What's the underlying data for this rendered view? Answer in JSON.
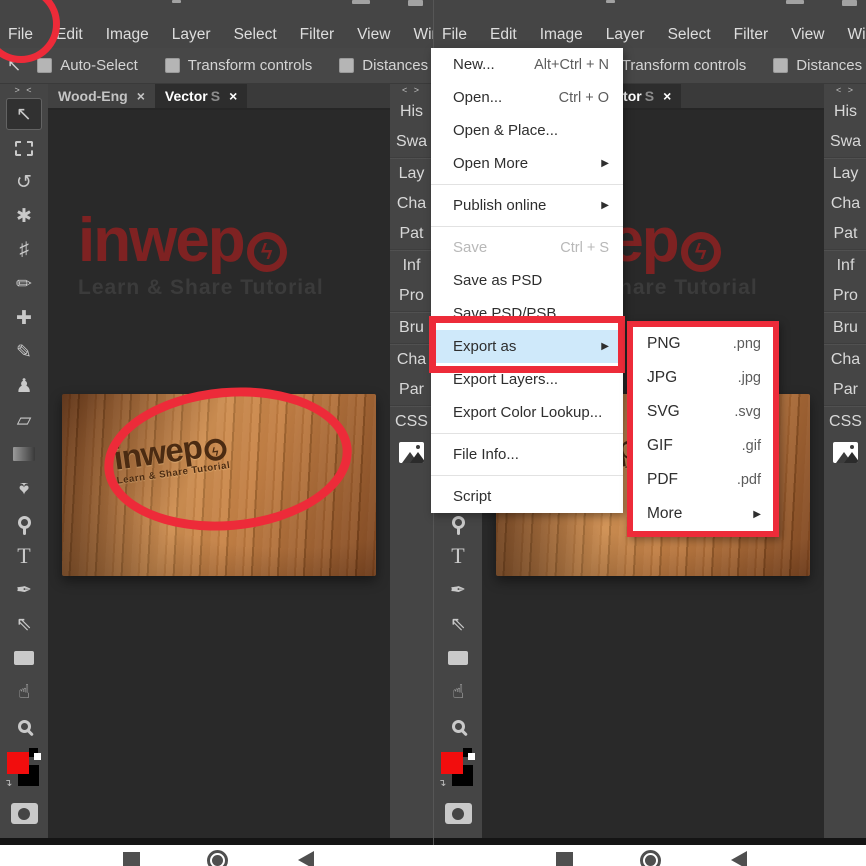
{
  "menubar": {
    "items": [
      "File",
      "Edit",
      "Image",
      "Layer",
      "Select",
      "Filter",
      "View",
      "Windo"
    ]
  },
  "optionsbar": {
    "move_tool_glyph": "↖",
    "auto_select": "Auto-Select",
    "transform_controls": "Transform controls",
    "distances": "Distances"
  },
  "tabs": {
    "tab1_label": "Wood-Eng",
    "tab2_label": "Vector",
    "tab2_tail": "S",
    "close": "×"
  },
  "tool_column": {
    "header": "> <",
    "tools": [
      {
        "name": "move-tool",
        "glyph": "↖"
      },
      {
        "name": "marquee-tool",
        "glyph": ""
      },
      {
        "name": "lasso-tool",
        "glyph": "↺"
      },
      {
        "name": "quick-select-tool",
        "glyph": "✱"
      },
      {
        "name": "crop-tool",
        "glyph": "♯"
      },
      {
        "name": "eyedropper-tool",
        "glyph": "✏"
      },
      {
        "name": "healing-tool",
        "glyph": "✚"
      },
      {
        "name": "brush-tool",
        "glyph": "✎"
      },
      {
        "name": "clone-stamp-tool",
        "glyph": "♟"
      },
      {
        "name": "eraser-tool",
        "glyph": "▱"
      },
      {
        "name": "gradient-tool",
        "glyph": ""
      },
      {
        "name": "blur-tool",
        "glyph": "♠"
      },
      {
        "name": "dodge-tool",
        "glyph": ""
      },
      {
        "name": "type-tool",
        "glyph": "T"
      },
      {
        "name": "pen-tool",
        "glyph": "✒"
      },
      {
        "name": "path-select-tool",
        "glyph": "⇖"
      },
      {
        "name": "shape-tool",
        "glyph": ""
      },
      {
        "name": "hand-tool",
        "glyph": "☝"
      },
      {
        "name": "zoom-tool",
        "glyph": ""
      }
    ],
    "swap_arrow": "↴"
  },
  "panel_strip": {
    "header": "< >",
    "groups": [
      [
        "His",
        "Swa"
      ],
      [
        "Lay",
        "Cha",
        "Pat"
      ],
      [
        "Inf",
        "Pro"
      ],
      [
        "Bru"
      ],
      [
        "Cha",
        "Par"
      ],
      [
        "CSS"
      ]
    ],
    "flat": {
      "0": "His",
      "1": "Swa",
      "2": "Lay",
      "3": "Cha",
      "4": "Pat",
      "5": "Inf",
      "6": "Pro",
      "7": "Bru",
      "8": "Cha",
      "9": "Par",
      "10": "CSS"
    }
  },
  "canvas": {
    "logo_word": "inwep",
    "logo_bolt": "ϟ",
    "logo_tagline": "Learn & Share Tutorial",
    "wood_logo_word": "inwep",
    "wood_tagline": "Learn & Share Tutorial"
  },
  "file_menu": {
    "items": [
      {
        "label": "New...",
        "shortcut": "Alt+Ctrl + N"
      },
      {
        "label": "Open...",
        "shortcut": "Ctrl + O"
      },
      {
        "label": "Open & Place..."
      },
      {
        "label": "Open More",
        "arrow": "▶"
      },
      {
        "label": "Publish online",
        "arrow": "▶"
      },
      {
        "label": "Save",
        "shortcut": "Ctrl + S",
        "disabled": true
      },
      {
        "label": "Save as PSD"
      },
      {
        "label": "Save PSD/PSB..."
      },
      {
        "label": "Export as",
        "arrow": "▶",
        "highlighted": true
      },
      {
        "label": "Export Layers..."
      },
      {
        "label": "Export Color Lookup..."
      },
      {
        "label": "File Info..."
      },
      {
        "label": "Script"
      }
    ]
  },
  "export_submenu": {
    "items": [
      {
        "label": "PNG",
        "ext": ".png"
      },
      {
        "label": "JPG",
        "ext": ".jpg"
      },
      {
        "label": "SVG",
        "ext": ".svg"
      },
      {
        "label": "GIF",
        "ext": ".gif"
      },
      {
        "label": "PDF",
        "ext": ".pdf"
      },
      {
        "label": "More",
        "ext": "▶"
      }
    ]
  },
  "colors": {
    "annotation_red": "#ed2b39",
    "menu_highlight_blue": "#cfe9fa",
    "logo_red": "#7e2222",
    "wood_engrave_brown": "#4b2b12",
    "foreground_swatch": "#f20d0d",
    "background_swatch": "#000000"
  }
}
